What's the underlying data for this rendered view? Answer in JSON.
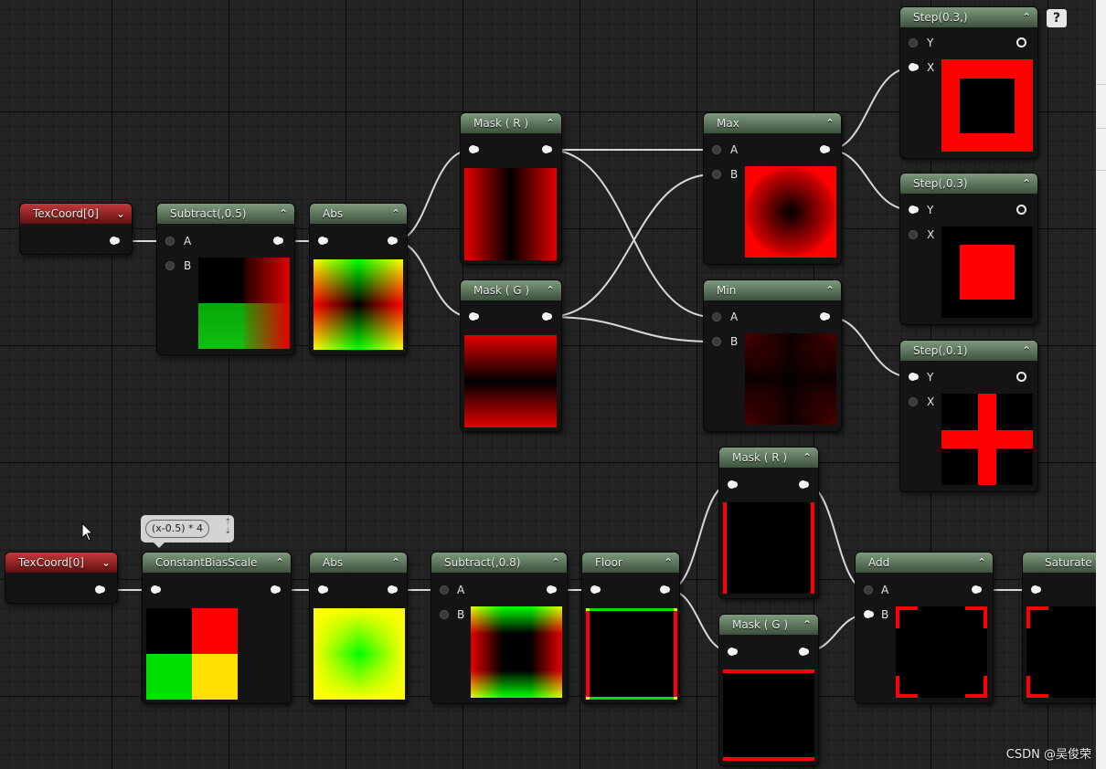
{
  "help_label": "?",
  "comment_bubble": {
    "text": "(x-0.5) * 4"
  },
  "watermark": "CSDN @吴俊荣",
  "nodes": {
    "texcoord1": {
      "title": "TexCoord[0]"
    },
    "subtract1": {
      "title": "Subtract(,0.5)",
      "pin_a": "A",
      "pin_b": "B"
    },
    "abs1": {
      "title": "Abs"
    },
    "maskr1": {
      "title": "Mask ( R )"
    },
    "maskg1": {
      "title": "Mask ( G )"
    },
    "max": {
      "title": "Max",
      "pin_a": "A",
      "pin_b": "B"
    },
    "min": {
      "title": "Min",
      "pin_a": "A",
      "pin_b": "B"
    },
    "step1": {
      "title": "Step(0.3,)",
      "pin_y": "Y",
      "pin_x": "X"
    },
    "step2": {
      "title": "Step(,0.3)",
      "pin_y": "Y",
      "pin_x": "X"
    },
    "step3": {
      "title": "Step(,0.1)",
      "pin_y": "Y",
      "pin_x": "X"
    },
    "texcoord2": {
      "title": "TexCoord[0]"
    },
    "cbs": {
      "title": "ConstantBiasScale"
    },
    "abs2": {
      "title": "Abs"
    },
    "subtract2": {
      "title": "Subtract(,0.8)",
      "pin_a": "A",
      "pin_b": "B"
    },
    "floor": {
      "title": "Floor"
    },
    "maskr2": {
      "title": "Mask ( R )"
    },
    "maskg2": {
      "title": "Mask ( G )"
    },
    "add": {
      "title": "Add",
      "pin_a": "A",
      "pin_b": "B"
    },
    "saturate": {
      "title": "Saturate"
    }
  }
}
